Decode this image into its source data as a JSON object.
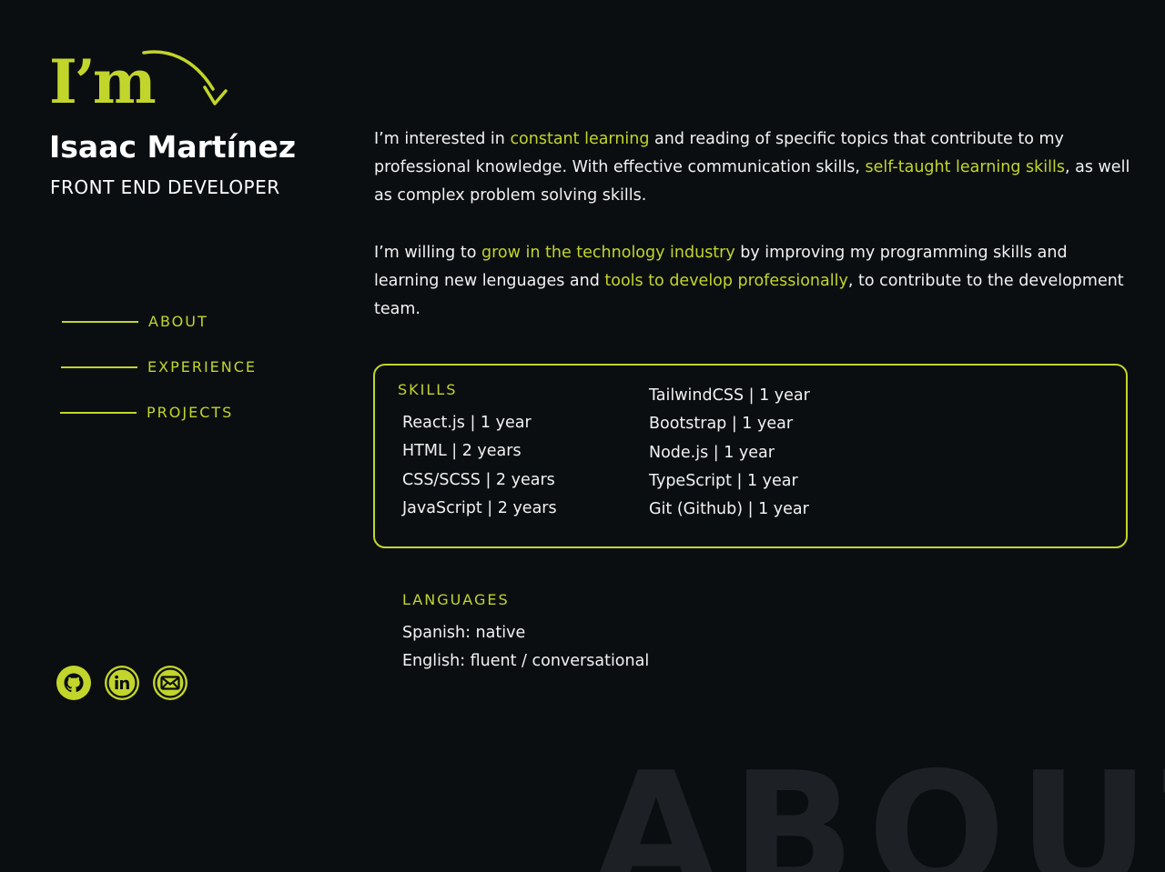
{
  "header": {
    "logo_text": "I’m",
    "name": "Isaac Martínez",
    "role": "FRONT END DEVELOPER"
  },
  "nav": {
    "items": [
      {
        "label": "ABOUT"
      },
      {
        "label": "EXPERIENCE"
      },
      {
        "label": "PROJECTS"
      }
    ]
  },
  "socials": [
    {
      "icon": "github-icon"
    },
    {
      "icon": "linkedin-icon"
    },
    {
      "icon": "mail-icon"
    }
  ],
  "about": {
    "p1": {
      "t1": "I’m interested in ",
      "h1": "constant learning",
      "t2": " and reading of specific topics that contribute to my professional knowledge. With effective communication skills, ",
      "h2": "self-taught learning skills",
      "t3": ", as well as complex problem solving skills."
    },
    "p2": {
      "t1": "I’m willing to ",
      "h1": "grow in the technology industry",
      "t2": " by improving my programming skills and learning new lenguages and ",
      "h2": "tools to develop professionally",
      "t3": ", to contribute to the development team."
    }
  },
  "skills": {
    "title": "SKILLS",
    "left": [
      "React.js | 1 year",
      "HTML | 2 years",
      "CSS/SCSS | 2 years",
      "JavaScript | 2 years"
    ],
    "right": [
      "TailwindCSS | 1 year",
      "Bootstrap | 1 year",
      "Node.js | 1 year",
      "TypeScript | 1 year",
      "Git (Github) | 1 year"
    ]
  },
  "languages": {
    "title": "LANGUAGES",
    "items": [
      "Spanish: native",
      "English: fluent / conversational"
    ]
  },
  "watermark": "ABOUT",
  "colors": {
    "accent": "#c2d52b",
    "background": "#0b0e11",
    "watermark": "#1d2024"
  }
}
